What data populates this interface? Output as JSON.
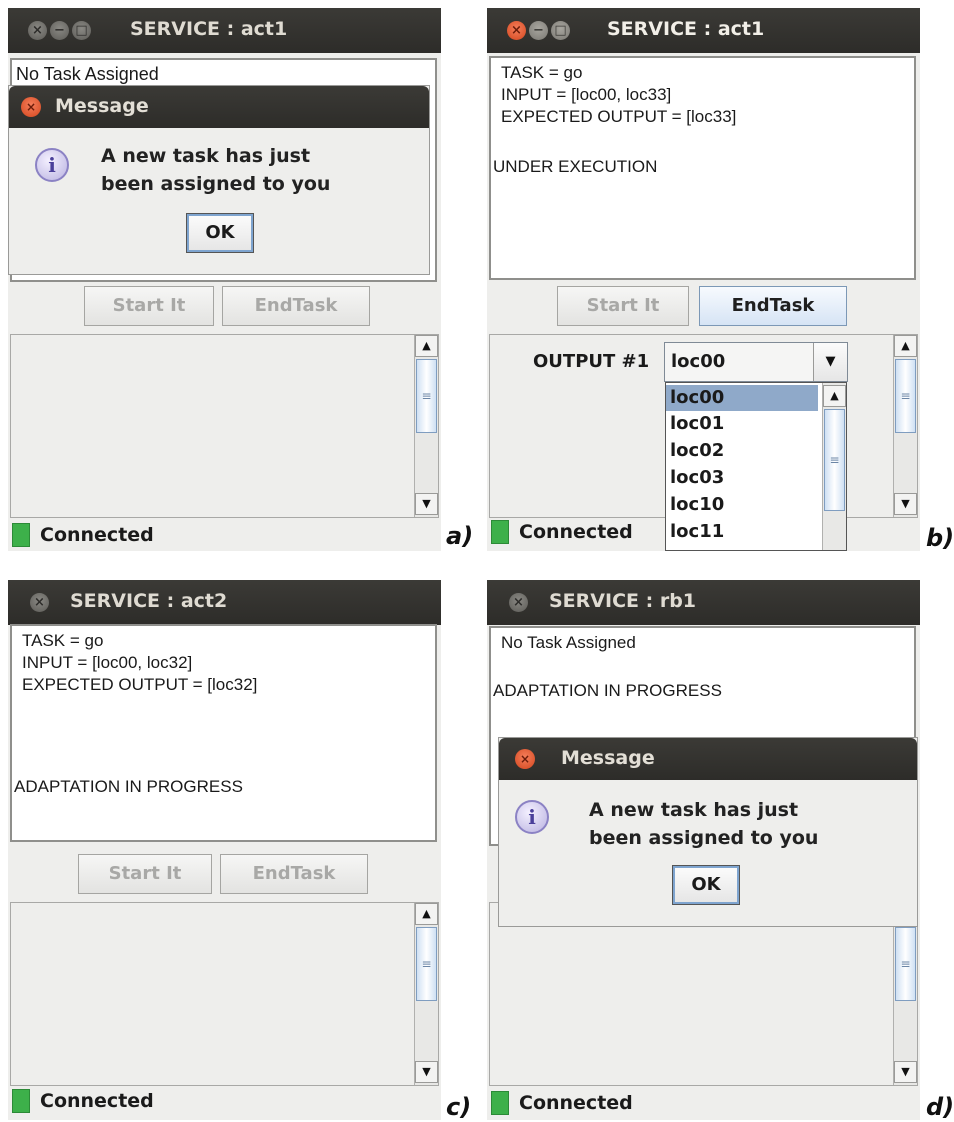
{
  "panels": {
    "a": {
      "panel_label": "a)",
      "title": "SERVICE : act1",
      "textarea_lines": [
        "No Task Assigned"
      ],
      "buttons": {
        "start": "Start It",
        "end": "EndTask"
      },
      "status": "Connected",
      "dialog": {
        "title": "Message",
        "line1": "A new task has just",
        "line2": "been assigned to you",
        "ok": "OK"
      }
    },
    "b": {
      "panel_label": "b)",
      "title": "SERVICE : act1",
      "textarea_lines": [
        "TASK = go",
        "INPUT = [loc00, loc33]",
        "EXPECTED OUTPUT = [loc33]",
        "",
        "UNDER EXECUTION"
      ],
      "buttons": {
        "start": "Start It",
        "end": "EndTask"
      },
      "output_label": "OUTPUT #1",
      "combo_value": "loc00",
      "dropdown_items": [
        "loc00",
        "loc01",
        "loc02",
        "loc03",
        "loc10",
        "loc11"
      ],
      "status": "Connected"
    },
    "c": {
      "panel_label": "c)",
      "title": "SERVICE : act2",
      "textarea_lines": [
        "TASK = go",
        "INPUT = [loc00, loc32]",
        "EXPECTED OUTPUT = [loc32]",
        "ADAPTATION IN PROGRESS"
      ],
      "buttons": {
        "start": "Start It",
        "end": "EndTask"
      },
      "status": "Connected"
    },
    "d": {
      "panel_label": "d)",
      "title": "SERVICE : rb1",
      "textarea_lines": [
        "No Task Assigned",
        "ADAPTATION IN PROGRESS"
      ],
      "status": "Connected",
      "dialog": {
        "title": "Message",
        "line1": "A new task has just",
        "line2": "been assigned to you",
        "ok": "OK"
      }
    }
  }
}
